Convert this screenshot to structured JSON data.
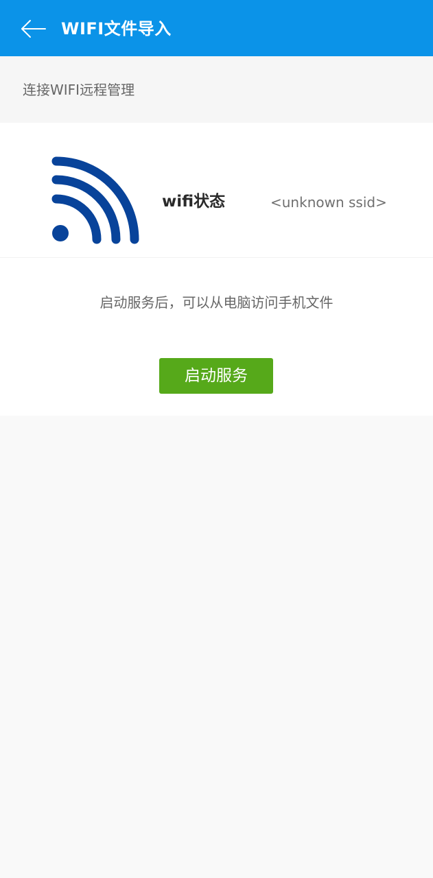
{
  "header": {
    "title": "WIFI文件导入",
    "back_icon": "arrow-left-icon"
  },
  "section": {
    "title": "连接WIFI远程管理"
  },
  "wifi": {
    "icon": "wifi-signal-icon",
    "status_label": "wifi状态",
    "ssid": "<unknown ssid>"
  },
  "service": {
    "description": "启动服务后，可以从电脑访问手机文件",
    "start_label": "启动服务"
  },
  "colors": {
    "app_bar": "#0b93e8",
    "wifi_icon": "#08439a",
    "start_button": "#56a91a",
    "page_background": "#f9f9f9"
  }
}
